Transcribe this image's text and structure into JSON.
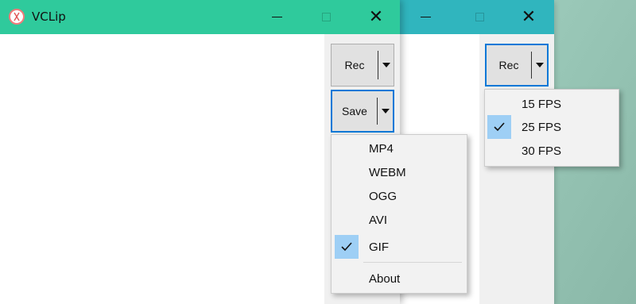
{
  "back_window": {
    "controls": {
      "minimize": "minimize",
      "maximize": "maximize",
      "close": "close"
    },
    "rec_button": {
      "label": "Rec"
    },
    "fps_menu": {
      "items": [
        {
          "label": "15 FPS",
          "checked": false
        },
        {
          "label": "25 FPS",
          "checked": true
        },
        {
          "label": "30 FPS",
          "checked": false
        }
      ]
    }
  },
  "front_window": {
    "title": "VCLip",
    "controls": {
      "minimize": "minimize",
      "maximize": "maximize",
      "close": "close"
    },
    "rec_button": {
      "label": "Rec"
    },
    "save_button": {
      "label": "Save"
    },
    "format_menu": {
      "items": [
        {
          "label": "MP4",
          "checked": false
        },
        {
          "label": "WEBM",
          "checked": false
        },
        {
          "label": "OGG",
          "checked": false
        },
        {
          "label": "AVI",
          "checked": false
        },
        {
          "label": "GIF",
          "checked": true
        }
      ],
      "about": "About"
    }
  },
  "colors": {
    "front_titlebar": "#2fca9c",
    "back_titlebar": "#30b5be",
    "focus_border": "#0078d7",
    "check_highlight": "#9ecff5"
  }
}
